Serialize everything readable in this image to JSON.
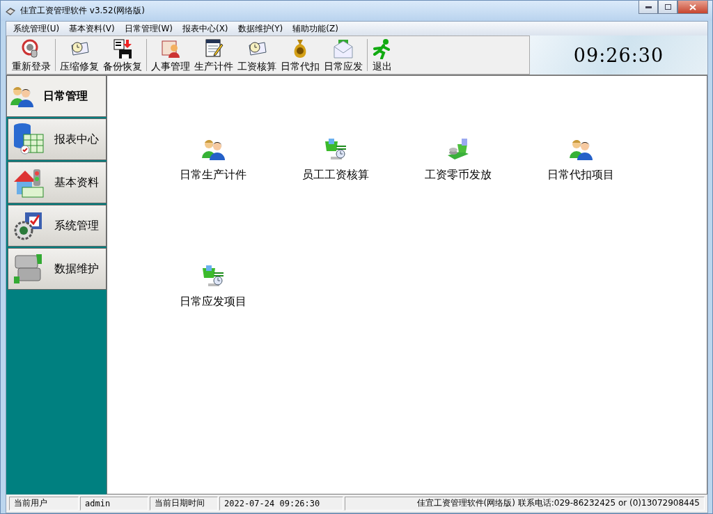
{
  "window": {
    "title": "佳宜工资管理软件 v3.52(网络版)"
  },
  "menu": [
    "系统管理(U)",
    "基本资料(V)",
    "日常管理(W)",
    "报表中心(X)",
    "数据维护(Y)",
    "辅助功能(Z)"
  ],
  "toolbar": {
    "groups": [
      {
        "buttons": [
          "重新登录"
        ]
      },
      {
        "buttons": [
          "压缩修复",
          "备份恢复"
        ]
      },
      {
        "buttons": [
          "人事管理",
          "生产计件",
          "工资核算",
          "日常代扣",
          "日常应发"
        ]
      },
      {
        "buttons": [
          "退出"
        ]
      }
    ]
  },
  "clock": "09:26:30",
  "sidebar": {
    "items": [
      {
        "label": "日常管理",
        "selected": true
      },
      {
        "label": "报表中心",
        "selected": false
      },
      {
        "label": "基本资料",
        "selected": false
      },
      {
        "label": "系统管理",
        "selected": false
      },
      {
        "label": "数据维护",
        "selected": false
      }
    ]
  },
  "shortcuts": [
    {
      "label": "日常生产计件",
      "kind": "people"
    },
    {
      "label": "员工工资核算",
      "kind": "box"
    },
    {
      "label": "工资零币发放",
      "kind": "money"
    },
    {
      "label": "日常代扣项目",
      "kind": "people"
    },
    {
      "label": "日常应发项目",
      "kind": "box"
    }
  ],
  "status_bar": [
    "当前用户",
    "admin",
    "当前日期时间",
    "2022-07-24 09:26:30",
    "佳宜工资管理软件(网络版)  联系电话:029-86232425 or (0)13072908445"
  ]
}
